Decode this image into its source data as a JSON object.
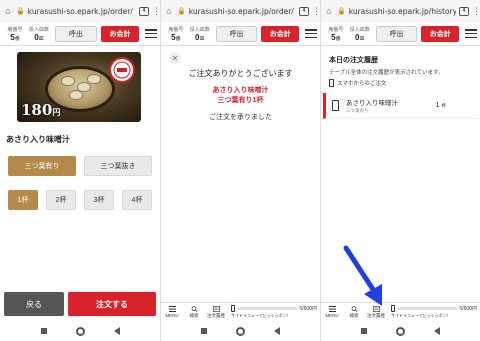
{
  "browser": {
    "urls": [
      "kurasushi-so.epark.jp/order/",
      "kurasushi-so.epark.jp/order/",
      "kurasushi-so.epark.jp/history"
    ],
    "tab_count": "4"
  },
  "header": {
    "seat_label": "席番号",
    "seat_value": "5",
    "seat_unit": "番",
    "count_label": "投入皿数",
    "count_value": "0",
    "count_unit": "皿",
    "call_label": "呼出",
    "pay_label": "お会計"
  },
  "product": {
    "price": "180",
    "price_unit": "円",
    "name": "あさり入り味噌汁",
    "options": [
      "三つ葉有り",
      "三つ葉抜き"
    ],
    "selected_option": "三つ葉有り",
    "quantities": [
      "1杯",
      "2杯",
      "3杯",
      "4杯"
    ],
    "selected_quantity": "1杯",
    "back_label": "戻る",
    "order_label": "注文する"
  },
  "confirm": {
    "close_icon": "close-icon",
    "thanks": "ご注文ありがとうございます",
    "item_line1": "あさり入り味噌汁",
    "item_line2": "三つ葉有り1杯",
    "accepted": "ご注文を承りました"
  },
  "history": {
    "title": "本日の注文履歴",
    "description": "テーブル全体の注文履歴が表示されています。",
    "smartphone_label": "スマホからのご注文",
    "item_name": "あさり入り味噌汁",
    "item_sub": "三つ葉有り",
    "item_qty": "1",
    "item_qty_unit": "杯"
  },
  "tabbar": {
    "menu": "MENU",
    "search": "検索",
    "history": "注文履歴",
    "progress_value": "0",
    "progress_total": "/500円",
    "progress_text": "サイドメニューでビッくらポン！",
    "progress_fraction": 0
  },
  "colors": {
    "accent": "#d6232c",
    "option_selected": "#b38a4a",
    "annotation_arrow": "#1f3fe0"
  }
}
